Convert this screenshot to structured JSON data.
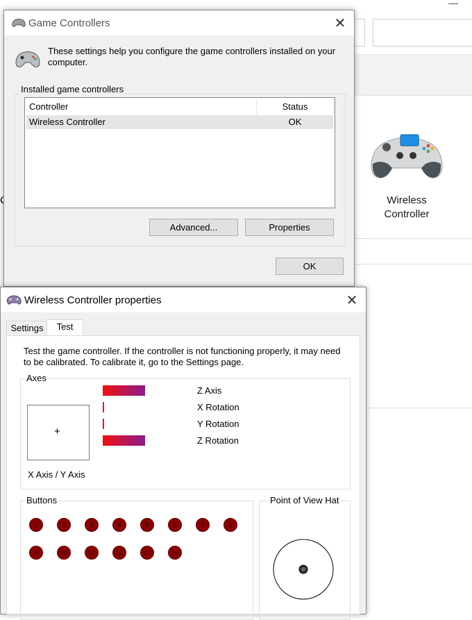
{
  "background_window": {
    "device_name": "Wireless Controller",
    "left_edge_char": "C"
  },
  "game_controllers": {
    "title": "Game Controllers",
    "description": "These settings help you configure the game controllers installed on your computer.",
    "group_label": "Installed game controllers",
    "columns": [
      "Controller",
      "Status"
    ],
    "rows": [
      {
        "controller": "Wireless Controller",
        "status": "OK"
      }
    ],
    "advanced_label": "Advanced...",
    "properties_label": "Properties",
    "ok_label": "OK"
  },
  "properties_window": {
    "title": "Wireless Controller properties",
    "tabs": [
      "Settings",
      "Test"
    ],
    "active_tab": "Test",
    "description_line1": "Test the game controller.  If the controller is not functioning properly, it may need",
    "description_line2": "to be calibrated.  To calibrate it, go to the Settings page.",
    "axes_label": "Axes",
    "xy_label": "X Axis / Y Axis",
    "crosshair": "+",
    "axis_bars": [
      {
        "name": "Z Axis",
        "level": 1.0
      },
      {
        "name": "X Rotation",
        "level": 0.0
      },
      {
        "name": "Y Rotation",
        "level": 0.0
      },
      {
        "name": "Z Rotation",
        "level": 1.0
      }
    ],
    "buttons_label": "Buttons",
    "buttons": [
      "1",
      "2",
      "3",
      "4",
      "5",
      "6",
      "7",
      "8",
      "9",
      "10",
      "11",
      "12",
      "13",
      "14"
    ],
    "pov_label": "Point of View Hat"
  },
  "colors": {
    "bar_start": "#f01010",
    "bar_end": "#8b1c8c",
    "button_fill": "#8b0000",
    "window_gray": "#f0f0f0"
  },
  "icons": {
    "gamepad_small": "gamepad-icon",
    "gamepad_large": "wireless-controller-icon",
    "close": "close-icon"
  }
}
